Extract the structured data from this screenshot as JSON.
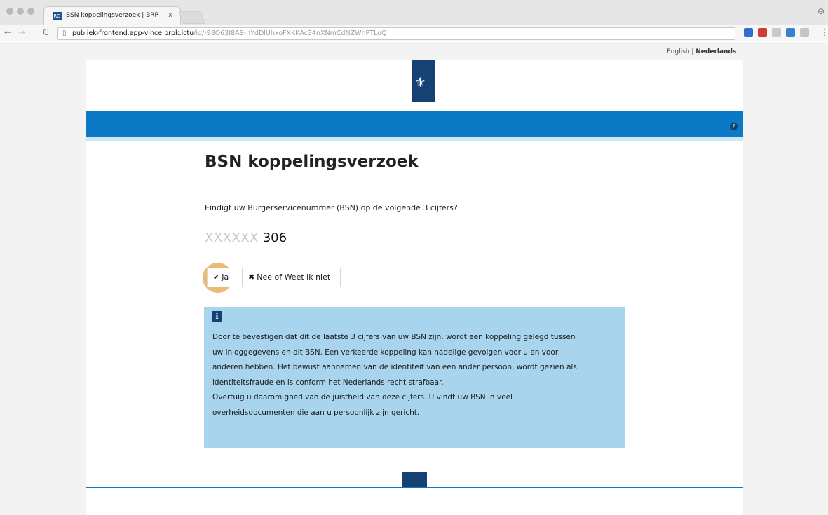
{
  "browser": {
    "tab_title": "BSN koppelingsverzoek | BRP",
    "tab_close": "x",
    "favicon_text": "RO",
    "url_host": "publiek-frontend.app-vince.brpk.ictu",
    "url_path": "/id/-98O63I8AS-nYdDlUhxoFXKKAc34nXNmCdNZWhPTLoQ",
    "nav_back": "←",
    "nav_forward": "→",
    "reload": "C",
    "page_icon": "▯",
    "menu": "⋮",
    "profile": "⊖",
    "extension_colors": [
      "#2f6fd1",
      "#d23b34",
      "#c9c9c9",
      "#3b7fd0",
      "#c4c4c4"
    ]
  },
  "page": {
    "language": {
      "english": "English",
      "separator": " | ",
      "dutch": "Nederlands"
    },
    "help_symbol": "?",
    "logo_glyph": "⚜",
    "title": "BSN koppelingsverzoek",
    "question": "Eindigt uw Burgerservicenummer (BSN) op de volgende 3 cijfers?",
    "bsn_mask": "XXXXXX",
    "bsn_digits": "306",
    "yes_button": {
      "symbol": "✔",
      "label": "Ja"
    },
    "no_button": {
      "symbol": "✖",
      "label": "Nee of Weet ik niet"
    },
    "info": {
      "icon": "i",
      "lines": [
        "Door te bevestigen dat dit de laatste 3 cijfers van uw BSN zijn, wordt een koppeling gelegd tussen",
        "uw inloggegevens en dit BSN. Een verkeerde koppeling kan nadelige gevolgen voor u en voor",
        "anderen hebben. Het bewust aannemen van de identiteit van een ander persoon, wordt gezien als",
        "identiteitsfraude en is conform het Nederlands recht strafbaar.",
        "Overtuig u daarom goed van de juistheid van deze cijfers. U vindt uw BSN in veel",
        "overheidsdocumenten die aan u persoonlijk zijn gericht."
      ]
    }
  }
}
